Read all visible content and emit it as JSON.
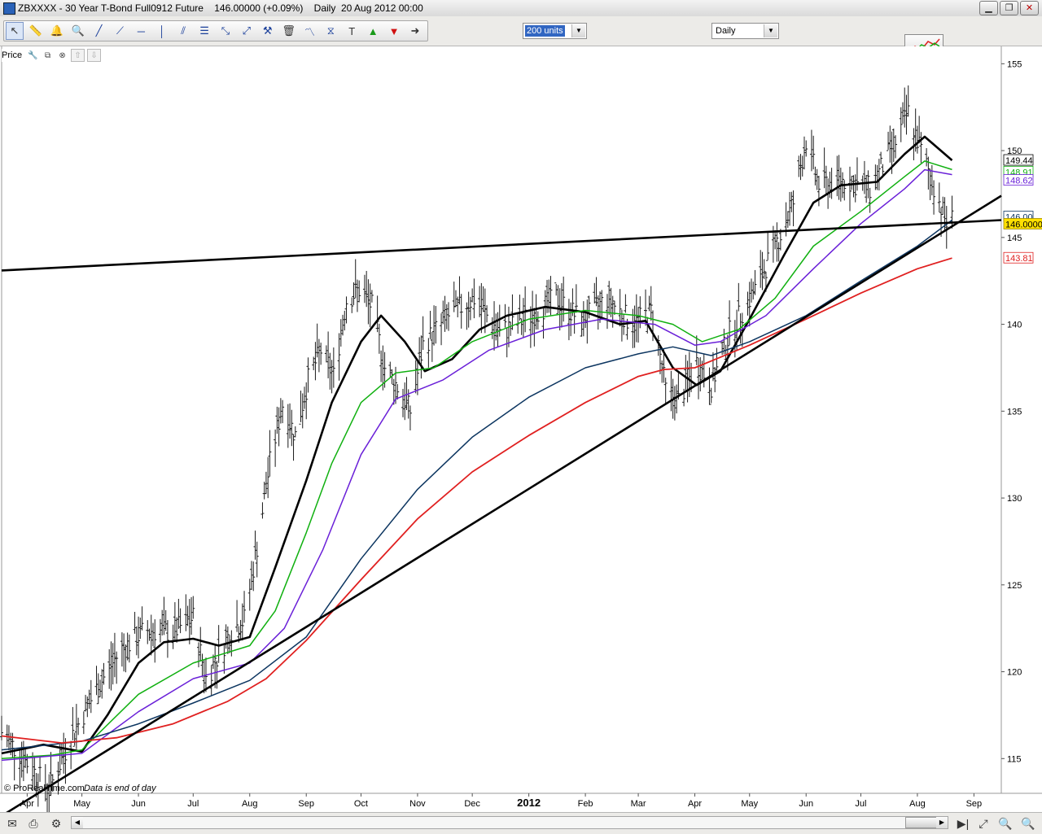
{
  "window": {
    "title": "ZBXXXX - 30 Year T-Bond Full0912 Future    146.00000 (+0.09%)    Daily  20 Aug 2012 00:00",
    "buttons": {
      "minimize": "▁",
      "restore": "❐",
      "close": "✕"
    }
  },
  "toolbar": {
    "tools": [
      {
        "name": "cursor-tool-icon",
        "glyph": "↖",
        "selected": true
      },
      {
        "name": "ruler-tool-icon",
        "glyph": "📏"
      },
      {
        "name": "alert-bell-icon",
        "glyph": "🔔"
      },
      {
        "name": "magnifier-icon",
        "glyph": "🔍"
      },
      {
        "name": "trendline-icon",
        "glyph": "╱"
      },
      {
        "name": "ray-line-icon",
        "glyph": "⟋"
      },
      {
        "name": "horizontal-line-icon",
        "glyph": "─"
      },
      {
        "name": "vertical-line-icon",
        "glyph": "│"
      },
      {
        "name": "parallel-lines-icon",
        "glyph": "⫽"
      },
      {
        "name": "fibonacci-icon",
        "glyph": "☰"
      },
      {
        "name": "extend-line-icon",
        "glyph": "⤡"
      },
      {
        "name": "channel-icon",
        "glyph": "⤢"
      },
      {
        "name": "tools-icon",
        "glyph": "⚒"
      },
      {
        "name": "trash-icon",
        "glyph": "🗑"
      },
      {
        "name": "pattern-icon",
        "glyph": "〽"
      },
      {
        "name": "triangle-pattern-icon",
        "glyph": "⧖"
      },
      {
        "name": "text-tool-icon",
        "glyph": "T"
      },
      {
        "name": "buy-arrow-icon",
        "glyph": "▲"
      },
      {
        "name": "sell-arrow-icon",
        "glyph": "▼"
      },
      {
        "name": "next-arrow-icon",
        "glyph": "➜"
      }
    ],
    "units_select": "200 units",
    "period_select": "Daily"
  },
  "panel": {
    "label": "Price"
  },
  "footer_note": {
    "brand": "© ProRealTime.com",
    "note": "Data is end of day"
  },
  "colors": {
    "black_ma": "#000000",
    "green_ma": "#10b010",
    "purple_ma": "#6a20d8",
    "navy_ma": "#0c3560",
    "red_ma": "#e02020",
    "candles": "#1a1a1a"
  },
  "chart_data": {
    "type": "line",
    "instrument": "ZBXXXX - 30 Year T-Bond Full0912 Future",
    "last_price": "146.00000",
    "change_pct": "+0.09%",
    "ylim": [
      113,
      156
    ],
    "y_ticks": [
      115,
      120,
      125,
      130,
      135,
      140,
      145,
      150,
      155
    ],
    "x_labels": [
      "Apr",
      "May",
      "Jun",
      "Jul",
      "Aug",
      "Sep",
      "Oct",
      "Nov",
      "Dec",
      "2012",
      "Feb",
      "Mar",
      "Apr",
      "May",
      "Jun",
      "Jul",
      "Aug",
      "Sep"
    ],
    "x_label_dates": [
      "2011-04-01",
      "2011-05-01",
      "2011-06-01",
      "2011-07-01",
      "2011-08-01",
      "2011-09-01",
      "2011-10-01",
      "2011-11-01",
      "2011-12-01",
      "2012-01-01",
      "2012-02-01",
      "2012-03-01",
      "2012-04-01",
      "2012-05-01",
      "2012-06-01",
      "2012-07-01",
      "2012-08-01",
      "2012-09-01"
    ],
    "xlim": [
      "2011-03-18",
      "2012-09-16"
    ],
    "price_path": [
      [
        "2011-03-18",
        116.5
      ],
      [
        "2011-04-03",
        114.5
      ],
      [
        "2011-04-13",
        113.2
      ],
      [
        "2011-04-25",
        116.2
      ],
      [
        "2011-05-08",
        118.8
      ],
      [
        "2011-05-22",
        121.2
      ],
      [
        "2011-06-05",
        122.4
      ],
      [
        "2011-06-20",
        122.3
      ],
      [
        "2011-07-01",
        123.1
      ],
      [
        "2011-07-08",
        119.6
      ],
      [
        "2011-07-15",
        121.0
      ],
      [
        "2011-07-22",
        122.4
      ],
      [
        "2011-07-29",
        123.0
      ],
      [
        "2011-08-05",
        127.2
      ],
      [
        "2011-08-12",
        132.0
      ],
      [
        "2011-08-19",
        135.4
      ],
      [
        "2011-08-26",
        133.6
      ],
      [
        "2011-09-02",
        136.8
      ],
      [
        "2011-09-09",
        138.5
      ],
      [
        "2011-09-16",
        137.0
      ],
      [
        "2011-09-23",
        141.4
      ],
      [
        "2011-09-30",
        142.0
      ],
      [
        "2011-10-07",
        141.0
      ],
      [
        "2011-10-14",
        137.5
      ],
      [
        "2011-10-21",
        136.4
      ],
      [
        "2011-10-28",
        135.0
      ],
      [
        "2011-11-04",
        138.8
      ],
      [
        "2011-11-18",
        140.5
      ],
      [
        "2011-12-02",
        141.5
      ],
      [
        "2011-12-16",
        139.5
      ],
      [
        "2012-01-02",
        140.5
      ],
      [
        "2012-01-16",
        141.5
      ],
      [
        "2012-01-30",
        140.2
      ],
      [
        "2012-02-13",
        141.5
      ],
      [
        "2012-02-27",
        140.0
      ],
      [
        "2012-03-09",
        140.8
      ],
      [
        "2012-03-16",
        136.2
      ],
      [
        "2012-03-23",
        135.6
      ],
      [
        "2012-04-02",
        137.8
      ],
      [
        "2012-04-10",
        136.5
      ],
      [
        "2012-04-20",
        139.5
      ],
      [
        "2012-05-04",
        142.0
      ],
      [
        "2012-05-18",
        145.2
      ],
      [
        "2012-05-25",
        147.0
      ],
      [
        "2012-06-01",
        150.6
      ],
      [
        "2012-06-08",
        148.0
      ],
      [
        "2012-06-22",
        148.3
      ],
      [
        "2012-07-06",
        147.8
      ],
      [
        "2012-07-20",
        150.5
      ],
      [
        "2012-07-27",
        152.2
      ],
      [
        "2012-08-03",
        150.0
      ],
      [
        "2012-08-10",
        148.0
      ],
      [
        "2012-08-17",
        145.8
      ],
      [
        "2012-08-20",
        146.0
      ]
    ],
    "series": [
      {
        "type": "moving_average",
        "label": "149.44",
        "points": [
          [
            "2011-03-18",
            115.3
          ],
          [
            "2011-04-10",
            115.8
          ],
          [
            "2011-05-01",
            115.4
          ],
          [
            "2011-05-15",
            117.5
          ],
          [
            "2011-06-01",
            120.5
          ],
          [
            "2011-06-15",
            121.7
          ],
          [
            "2011-07-01",
            121.9
          ],
          [
            "2011-07-15",
            121.5
          ],
          [
            "2011-08-01",
            122.0
          ],
          [
            "2011-08-15",
            126.0
          ],
          [
            "2011-09-01",
            131.0
          ],
          [
            "2011-09-15",
            135.5
          ],
          [
            "2011-10-01",
            139.0
          ],
          [
            "2011-10-12",
            140.5
          ],
          [
            "2011-10-25",
            139.0
          ],
          [
            "2011-11-05",
            137.3
          ],
          [
            "2011-11-20",
            138.0
          ],
          [
            "2011-12-05",
            139.7
          ],
          [
            "2011-12-20",
            140.5
          ],
          [
            "2012-01-10",
            141.0
          ],
          [
            "2012-02-01",
            140.7
          ],
          [
            "2012-02-20",
            140.0
          ],
          [
            "2012-03-05",
            140.2
          ],
          [
            "2012-03-20",
            137.5
          ],
          [
            "2012-04-02",
            136.5
          ],
          [
            "2012-04-15",
            137.3
          ],
          [
            "2012-05-01",
            140.3
          ],
          [
            "2012-05-20",
            144.0
          ],
          [
            "2012-06-05",
            147.0
          ],
          [
            "2012-06-20",
            148.0
          ],
          [
            "2012-07-10",
            148.2
          ],
          [
            "2012-07-25",
            149.8
          ],
          [
            "2012-08-05",
            150.8
          ],
          [
            "2012-08-20",
            149.44
          ]
        ]
      },
      {
        "type": "moving_average",
        "label": "148.91",
        "points": [
          [
            "2011-03-18",
            115.0
          ],
          [
            "2011-04-15",
            115.2
          ],
          [
            "2011-05-01",
            115.5
          ],
          [
            "2011-06-01",
            118.7
          ],
          [
            "2011-07-01",
            120.5
          ],
          [
            "2011-08-01",
            121.5
          ],
          [
            "2011-08-15",
            123.5
          ],
          [
            "2011-09-01",
            128.0
          ],
          [
            "2011-09-15",
            132.0
          ],
          [
            "2011-10-01",
            135.5
          ],
          [
            "2011-10-20",
            137.2
          ],
          [
            "2011-11-10",
            137.5
          ],
          [
            "2011-12-01",
            139.0
          ],
          [
            "2012-01-01",
            140.3
          ],
          [
            "2012-02-01",
            140.8
          ],
          [
            "2012-03-01",
            140.5
          ],
          [
            "2012-03-20",
            140.0
          ],
          [
            "2012-04-05",
            139.0
          ],
          [
            "2012-04-25",
            139.7
          ],
          [
            "2012-05-15",
            141.5
          ],
          [
            "2012-06-05",
            144.5
          ],
          [
            "2012-07-01",
            146.5
          ],
          [
            "2012-07-25",
            148.5
          ],
          [
            "2012-08-05",
            149.4
          ],
          [
            "2012-08-20",
            148.91
          ]
        ]
      },
      {
        "type": "moving_average",
        "label": "148.62",
        "points": [
          [
            "2011-03-18",
            114.9
          ],
          [
            "2011-05-01",
            115.3
          ],
          [
            "2011-06-01",
            117.7
          ],
          [
            "2011-07-01",
            119.6
          ],
          [
            "2011-08-01",
            120.5
          ],
          [
            "2011-08-20",
            122.5
          ],
          [
            "2011-09-10",
            127.0
          ],
          [
            "2011-10-01",
            132.5
          ],
          [
            "2011-10-20",
            135.7
          ],
          [
            "2011-11-15",
            136.8
          ],
          [
            "2011-12-10",
            138.5
          ],
          [
            "2012-01-10",
            139.7
          ],
          [
            "2012-02-10",
            140.3
          ],
          [
            "2012-03-10",
            140.0
          ],
          [
            "2012-04-01",
            138.8
          ],
          [
            "2012-04-15",
            139.0
          ],
          [
            "2012-05-10",
            140.5
          ],
          [
            "2012-06-05",
            143.2
          ],
          [
            "2012-07-01",
            145.8
          ],
          [
            "2012-07-25",
            147.8
          ],
          [
            "2012-08-05",
            148.9
          ],
          [
            "2012-08-20",
            148.62
          ]
        ]
      },
      {
        "type": "moving_average",
        "label": "146.00",
        "points": [
          [
            "2011-03-18",
            115.5
          ],
          [
            "2011-05-01",
            116.0
          ],
          [
            "2011-06-01",
            117.0
          ],
          [
            "2011-07-01",
            118.2
          ],
          [
            "2011-08-01",
            119.5
          ],
          [
            "2011-09-01",
            122.0
          ],
          [
            "2011-10-01",
            126.5
          ],
          [
            "2011-11-01",
            130.5
          ],
          [
            "2011-12-01",
            133.5
          ],
          [
            "2012-01-01",
            135.8
          ],
          [
            "2012-02-01",
            137.5
          ],
          [
            "2012-03-01",
            138.3
          ],
          [
            "2012-03-20",
            138.7
          ],
          [
            "2012-04-10",
            138.2
          ],
          [
            "2012-05-01",
            139.0
          ],
          [
            "2012-06-01",
            140.5
          ],
          [
            "2012-07-01",
            142.5
          ],
          [
            "2012-08-01",
            144.5
          ],
          [
            "2012-08-20",
            146.0
          ]
        ]
      },
      {
        "type": "moving_average",
        "label": "143.81",
        "points": [
          [
            "2011-03-18",
            116.3
          ],
          [
            "2011-04-20",
            115.9
          ],
          [
            "2011-05-20",
            116.2
          ],
          [
            "2011-06-20",
            117.0
          ],
          [
            "2011-07-20",
            118.3
          ],
          [
            "2011-08-10",
            119.6
          ],
          [
            "2011-09-01",
            121.8
          ],
          [
            "2011-10-01",
            125.3
          ],
          [
            "2011-11-01",
            128.8
          ],
          [
            "2011-12-01",
            131.5
          ],
          [
            "2012-01-01",
            133.6
          ],
          [
            "2012-02-01",
            135.5
          ],
          [
            "2012-03-01",
            137.0
          ],
          [
            "2012-03-15",
            137.4
          ],
          [
            "2012-04-01",
            137.5
          ],
          [
            "2012-05-01",
            138.8
          ],
          [
            "2012-06-01",
            140.3
          ],
          [
            "2012-07-01",
            141.8
          ],
          [
            "2012-08-01",
            143.2
          ],
          [
            "2012-08-20",
            143.81
          ]
        ]
      }
    ],
    "trendlines": [
      {
        "type": "support",
        "from": [
          "2011-03-18",
          111.7
        ],
        "to": [
          "2012-09-16",
          147.4
        ]
      },
      {
        "type": "resistance",
        "from": [
          "2011-03-18",
          143.1
        ],
        "to": [
          "2012-09-16",
          146.0
        ]
      }
    ],
    "price_labels": [
      "149.44",
      "148.91",
      "148.62",
      "146.00",
      "146.00000",
      "143.81"
    ],
    "grid": false
  }
}
